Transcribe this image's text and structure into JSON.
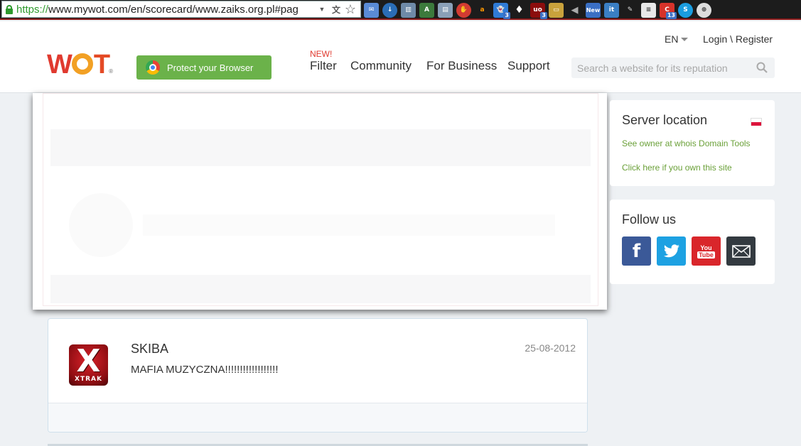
{
  "browser": {
    "url_scheme": "https://",
    "url_rest": "www.mywot.com/en/scorecard/www.zaiks.org.pl#pag",
    "extension_badges": [
      "3",
      "3",
      "13"
    ],
    "new_badge": "New",
    "it_label": "it",
    "ud_label": "uo"
  },
  "header": {
    "language": "EN",
    "login_register": "Login \\ Register",
    "logo_w": "W",
    "logo_t": "T",
    "logo_reg": "®",
    "protect_button": "Protect your Browser",
    "new_tag": "NEW!",
    "nav": {
      "filter": "Filter",
      "community": "Community",
      "business": "For Business",
      "support": "Support"
    },
    "search_placeholder": "Search a website for its reputation"
  },
  "review": {
    "reviewer": "SKIBA",
    "date": "25-08-2012",
    "text": "MAFIA MUZYCZNA!!!!!!!!!!!!!!!!!!",
    "avatar_letter": "X",
    "avatar_brand": "XTRAK"
  },
  "sidebar": {
    "server_location": {
      "title": "Server location",
      "whois_link": "See owner at whois Domain Tools",
      "own_link": "Click here if you own this site"
    },
    "follow": {
      "title": "Follow us",
      "facebook": "f",
      "youtube_you": "You",
      "youtube_tube": "Tube"
    }
  },
  "colors": {
    "accent_green": "#6bb24a",
    "link_green": "#6aa038",
    "facebook": "#3b5998",
    "twitter": "#1da1e2",
    "youtube": "#d9262b",
    "email": "#333a40"
  }
}
